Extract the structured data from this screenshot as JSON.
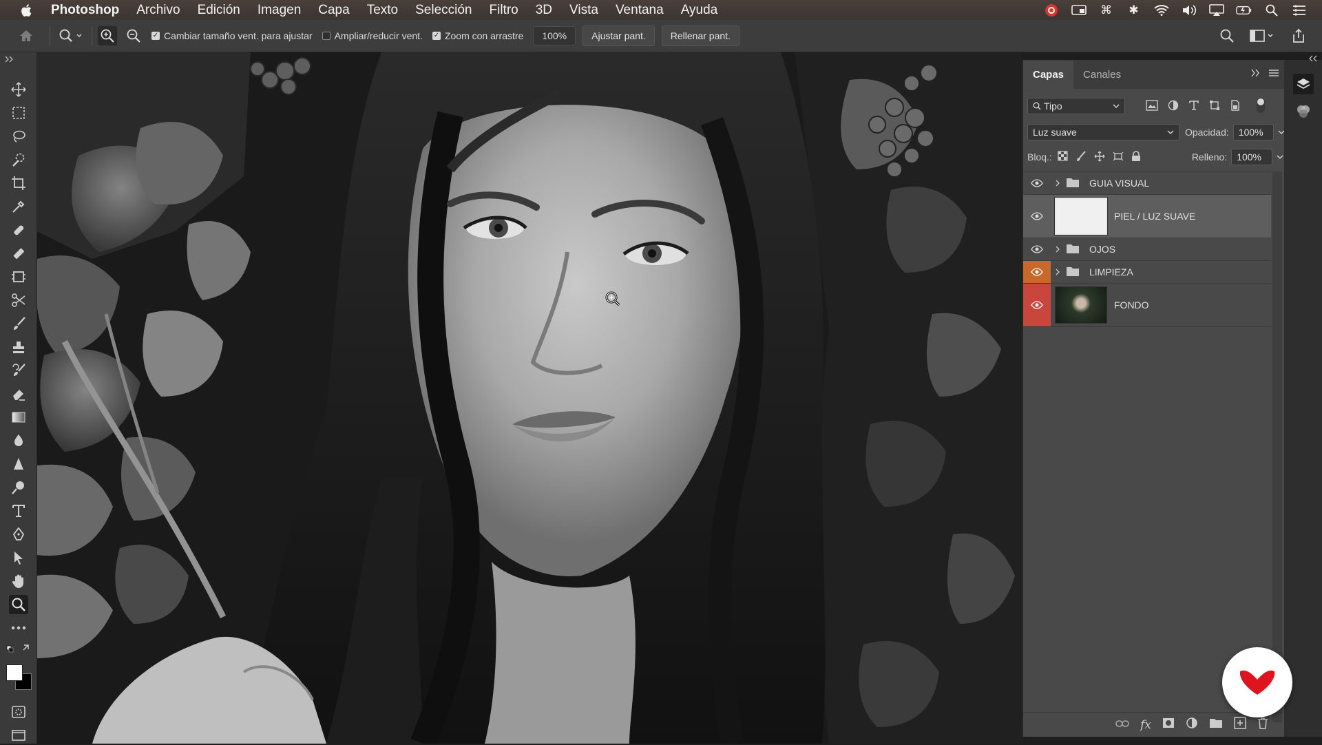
{
  "menubar": {
    "items": [
      "Photoshop",
      "Archivo",
      "Edición",
      "Imagen",
      "Capa",
      "Texto",
      "Selección",
      "Filtro",
      "3D",
      "Vista",
      "Ventana",
      "Ayuda"
    ]
  },
  "options_bar": {
    "checkbox_resize": "Cambiar tamaño vent. para ajustar",
    "checkbox_resize_checked": true,
    "checkbox_zoom_all": "Ampliar/reducir vent.",
    "checkbox_zoom_all_checked": false,
    "checkbox_scrubby": "Zoom con arrastre",
    "checkbox_scrubby_checked": true,
    "zoom_value": "100%",
    "fit_screen": "Ajustar pant.",
    "fill_screen": "Rellenar pant."
  },
  "layers_panel": {
    "tab_layers": "Capas",
    "tab_channels": "Canales",
    "filter_kind": "Tipo",
    "blend_mode": "Luz suave",
    "opacity_label": "Opacidad:",
    "opacity_value": "100%",
    "lock_label": "Bloq.:",
    "fill_label": "Relleno:",
    "fill_value": "100%",
    "layers": [
      {
        "name": "GUIA VISUAL",
        "type": "group",
        "eye_color": "none"
      },
      {
        "name": "PIEL / LUZ SUAVE",
        "type": "pixel",
        "eye_color": "none"
      },
      {
        "name": "OJOS",
        "type": "group",
        "eye_color": "none"
      },
      {
        "name": "LIMPIEZA",
        "type": "group",
        "eye_color": "#c8692c"
      },
      {
        "name": "FONDO",
        "type": "image",
        "eye_color": "#c9463d"
      }
    ]
  },
  "colors": {
    "accent_orange": "#c8692c",
    "accent_red": "#c9463d",
    "badge_red": "#e0141e"
  }
}
